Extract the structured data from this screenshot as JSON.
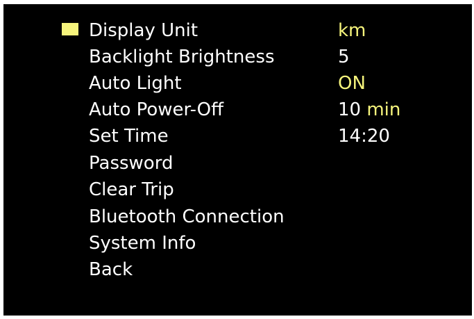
{
  "menu": {
    "items": [
      {
        "label": "Display Unit",
        "value": "km",
        "value_unit": "",
        "selected": true
      },
      {
        "label": "Backlight Brightness",
        "value": "5",
        "value_unit": ""
      },
      {
        "label": "Auto Light",
        "value": "ON",
        "value_unit": ""
      },
      {
        "label": "Auto Power-Off",
        "value": "10",
        "value_unit": "min"
      },
      {
        "label": "Set Time",
        "value": "14:20",
        "value_unit": ""
      },
      {
        "label": "Password"
      },
      {
        "label": "Clear Trip"
      },
      {
        "label": "Bluetooth Connection"
      },
      {
        "label": "System Info"
      },
      {
        "label": "Back"
      }
    ]
  },
  "colors": {
    "background": "#000000",
    "text": "#ffffff",
    "highlight": "#f6f47c"
  },
  "icons": {
    "selection_cursor": "filled-square-icon"
  }
}
